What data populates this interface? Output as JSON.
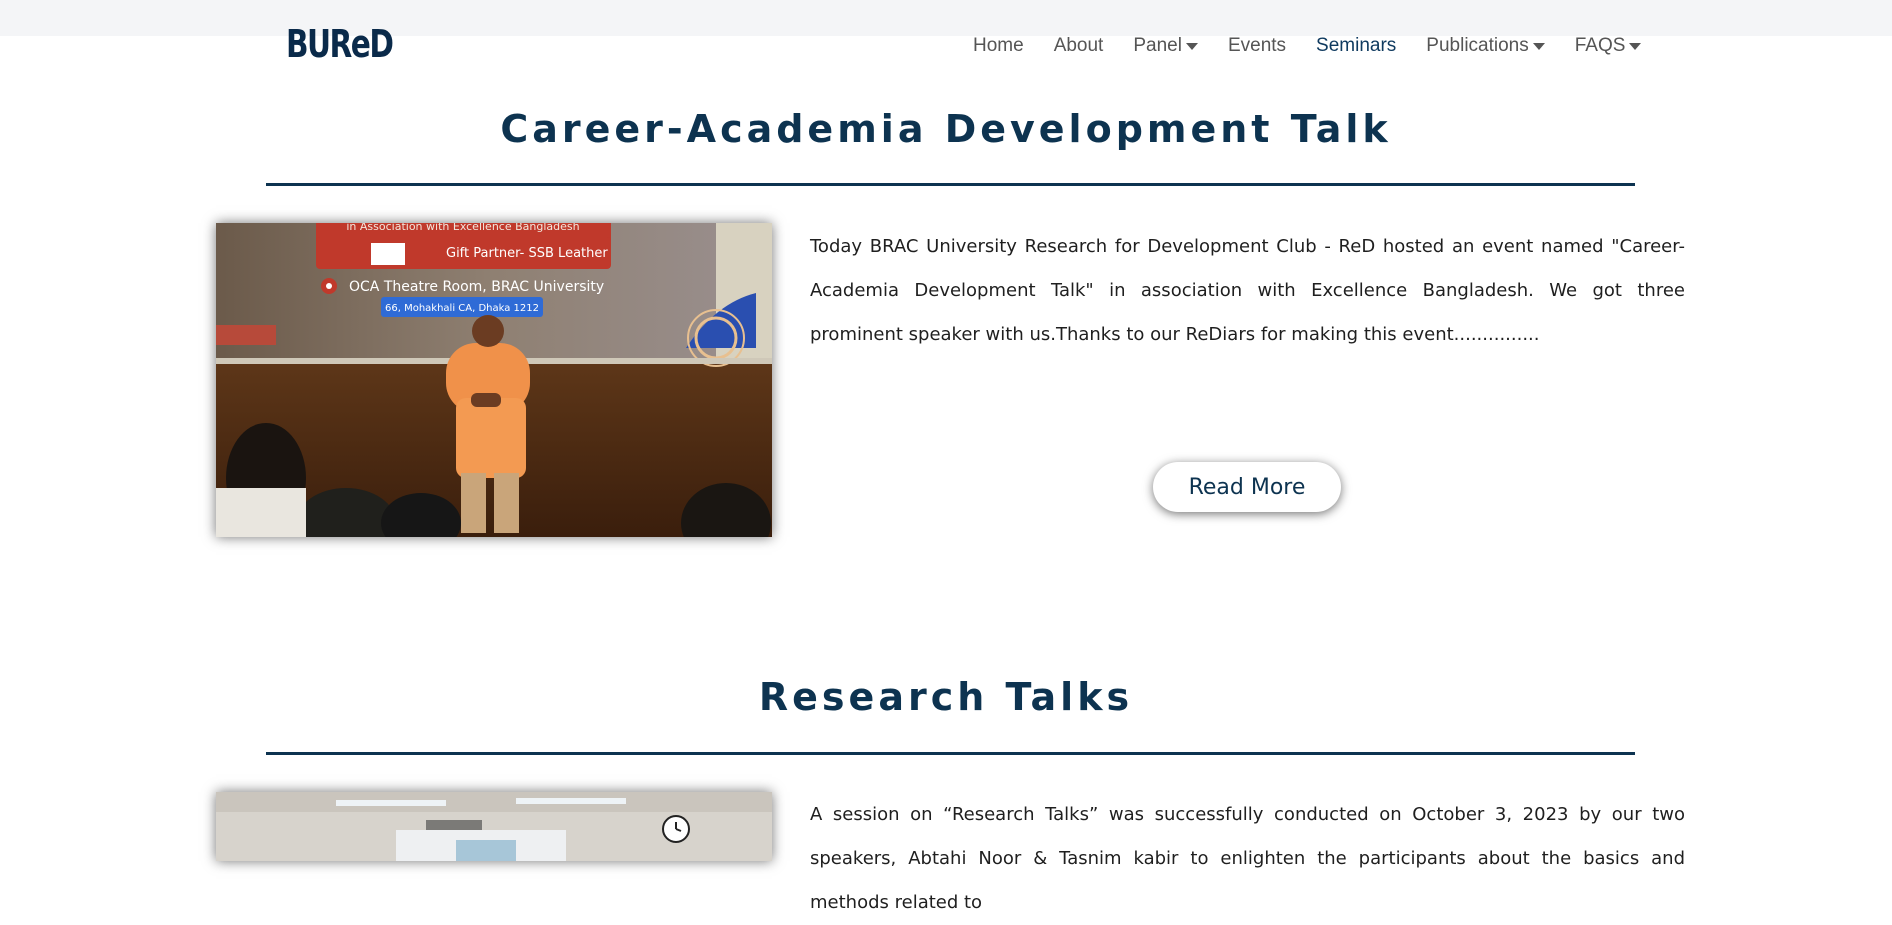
{
  "brand": {
    "logo_text": "BUReD"
  },
  "nav": {
    "items": [
      {
        "label": "Home"
      },
      {
        "label": "About"
      },
      {
        "label": "Panel"
      },
      {
        "label": "Events"
      },
      {
        "label": "Seminars"
      },
      {
        "label": "Publications"
      },
      {
        "label": "FAQS"
      }
    ]
  },
  "sections": [
    {
      "title": "Career-Academia Development Talk",
      "description": "Today BRAC University Research for Development Club - ReD hosted an event named \"Career-Academia Development Talk\" in association with Excellence Bangladesh. We got three prominent speaker with us.Thanks to our ReDiars for making this event...............",
      "button_label": "Read More",
      "banner": {
        "line1": "in Association with Excellence Bangladesh",
        "line2": "Gift Partner- SSB Leather",
        "line3": "OCA Theatre Room, BRAC University",
        "line4": "66, Mohakhali CA, Dhaka 1212"
      }
    },
    {
      "title": "Research Talks",
      "description": "A session on “Research Talks” was successfully conducted on October 3, 2023 by our two speakers, Abtahi Noor & Tasnim kabir to enlighten the participants about the basics and methods related to"
    }
  ],
  "colors": {
    "brand_navy": "#0d3350",
    "nav_active": "#0f3a5f",
    "nav_text": "#555555"
  }
}
